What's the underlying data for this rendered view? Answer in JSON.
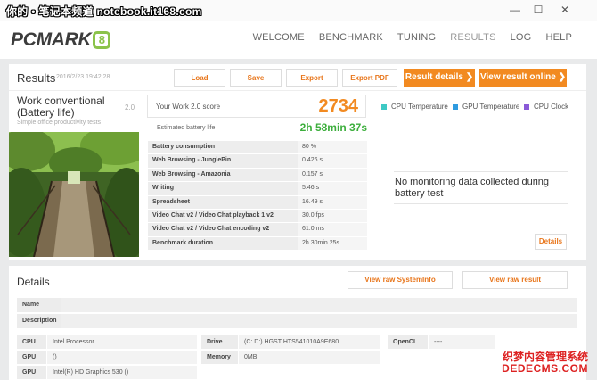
{
  "watermark_top": "你的 • 笔记本频道 notebook.it168.com",
  "window_controls": [
    "—",
    "☐",
    "✕"
  ],
  "app": {
    "logo": "PCMARK",
    "logo_badge": "8"
  },
  "nav": [
    "WELCOME",
    "BENCHMARK",
    "TUNING",
    "RESULTS",
    "LOG",
    "HELP"
  ],
  "nav_active": "RESULTS",
  "results": {
    "title": "Results",
    "date": "2016/2/23 19:42:28",
    "buttons": {
      "load": "Load",
      "save": "Save",
      "export": "Export",
      "export_pdf": "Export PDF"
    },
    "result_details": "Result details ❯",
    "view_online": "View result online ❯",
    "bench_name": "Work conventional (Battery life)",
    "bench_version": "2.0",
    "bench_sub": "Simple office productivity tests",
    "score_label": "Your Work 2.0 score",
    "score": "2734",
    "est_label": "Estimated battery life",
    "est_value": "2h 58min 37s",
    "metrics": [
      {
        "label": "Battery consumption",
        "value": "80 %"
      },
      {
        "label": "Web Browsing - JunglePin",
        "value": "0.426 s"
      },
      {
        "label": "Web Browsing - Amazonia",
        "value": "0.157 s"
      },
      {
        "label": "Writing",
        "value": "5.46 s"
      },
      {
        "label": "Spreadsheet",
        "value": "16.49 s"
      },
      {
        "label": "Video Chat v2 / Video Chat playback 1 v2",
        "value": "30.0 fps"
      },
      {
        "label": "Video Chat v2 / Video Chat encoding v2",
        "value": "61.0 ms"
      },
      {
        "label": "Benchmark duration",
        "value": "2h 30min 25s"
      }
    ],
    "legend": [
      {
        "label": "CPU Temperature",
        "color": "#3ec9c4"
      },
      {
        "label": "GPU Temperature",
        "color": "#2e9be0"
      },
      {
        "label": "CPU Clock",
        "color": "#8a5ad8"
      }
    ],
    "no_monitoring": "No monitoring data collected during battery test",
    "details_btn": "Details"
  },
  "details": {
    "title": "Details",
    "view_sysinfo": "View raw SystemInfo",
    "view_result": "View raw result",
    "name_label": "Name",
    "desc_label": "Description",
    "cpu_label": "CPU",
    "cpu_value": "Intel Processor",
    "gpu1_label": "GPU",
    "gpu1_value": "()",
    "gpu2_label": "GPU",
    "gpu2_value": "Intel(R) HD Graphics 530 ()",
    "drive_label": "Drive",
    "drive_value": "(C: D:) HGST HTS541010A9E680",
    "memory_label": "Memory",
    "memory_value": "0MB",
    "opencl_label": "OpenCL",
    "opencl_value": "----"
  },
  "watermark_bottom": {
    "line1": "织梦内容管理系统",
    "line2": "DEDECMS.COM"
  }
}
